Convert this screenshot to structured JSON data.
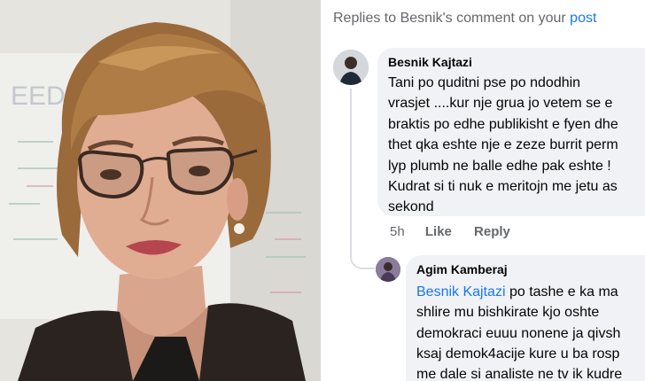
{
  "photo": {
    "wall_text": "EED"
  },
  "replies_header": {
    "prefix": "Replies to Besnik's comment on your ",
    "link": "post"
  },
  "comments": [
    {
      "author": "Besnik Kajtazi",
      "lines": [
        "Tani po quditni pse po ndodhin",
        "vrasjet ....kur nje grua jo vetem se e",
        "braktis po edhe publikisht e fyen dhe",
        "thet qka eshte nje e zeze burrit perm",
        "lyp plumb ne balle edhe pak eshte !",
        "Kudrat si ti nuk e meritojn me jetu as",
        "sekond"
      ],
      "time": "5h",
      "like": "Like",
      "reply": "Reply"
    },
    {
      "author": "Agim Kamberaj",
      "mention": "Besnik Kajtazi",
      "first_line_rest": " po tashe e ka ma",
      "lines": [
        "shlire mu bishkirate kjo oshte",
        "demokraci euuu nonene ja qivsh",
        "ksaj demok4acije kure u ba rosp",
        "me dale si analiste ne tv ik kudre"
      ]
    }
  ],
  "colors": {
    "link": "#1877f2",
    "meta": "#65676b",
    "bubble": "#f0f2f5",
    "text": "#050505"
  }
}
